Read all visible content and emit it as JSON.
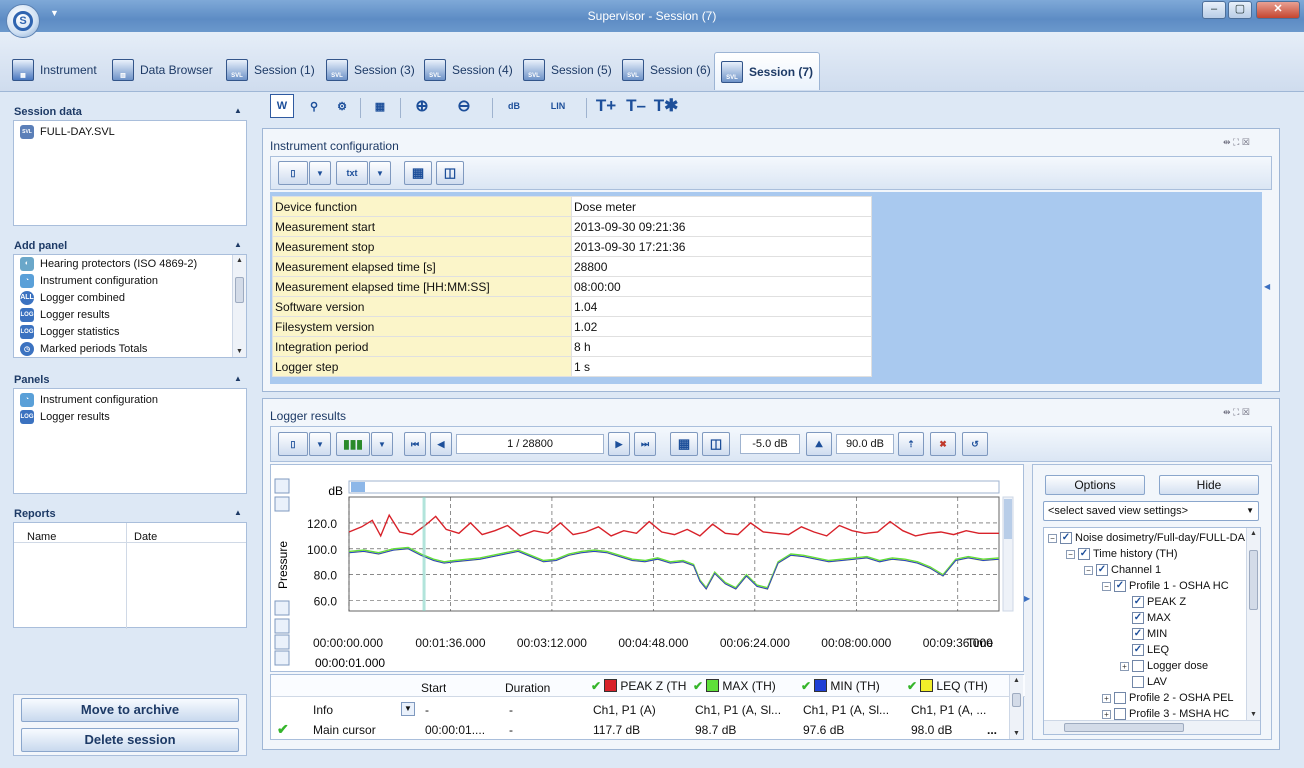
{
  "window": {
    "title": "Supervisor - Session (7)",
    "min": "–",
    "max": "▢",
    "close": "✕"
  },
  "tabs": [
    {
      "label": "Instrument"
    },
    {
      "label": "Data Browser"
    },
    {
      "label": "Session (1)"
    },
    {
      "label": "Session (3)"
    },
    {
      "label": "Session (4)"
    },
    {
      "label": "Session (5)"
    },
    {
      "label": "Session (6)"
    },
    {
      "label": "Session (7)"
    }
  ],
  "sidebar": {
    "session_data": {
      "title": "Session data",
      "items": [
        "FULL-DAY.SVL"
      ]
    },
    "add_panel": {
      "title": "Add panel",
      "items": [
        "Hearing protectors (ISO 4869-2)",
        "Instrument configuration",
        "Logger combined",
        "Logger results",
        "Logger statistics",
        "Marked periods Totals"
      ]
    },
    "panels": {
      "title": "Panels",
      "items": [
        "Instrument configuration",
        "Logger results"
      ]
    },
    "reports": {
      "title": "Reports",
      "col_name": "Name",
      "col_date": "Date"
    },
    "move_to_archive": "Move to archive",
    "delete_session": "Delete session"
  },
  "icons": {
    "log": "LOG",
    "all": "ALL",
    "svl": "SVL",
    "txt": "txt",
    "db": "dB",
    "lin": "LIN",
    "t_plus": "T+",
    "t_minus": "T–",
    "t_star": "T✱"
  },
  "instrument_config": {
    "title": "Instrument configuration",
    "rows": [
      {
        "key": "Device function",
        "value": "Dose meter"
      },
      {
        "key": "Measurement start",
        "value": "2013-09-30 09:21:36"
      },
      {
        "key": "Measurement stop",
        "value": "2013-09-30 17:21:36"
      },
      {
        "key": "Measurement elapsed time [s]",
        "value": "28800"
      },
      {
        "key": "Measurement elapsed time [HH:MM:SS]",
        "value": "08:00:00"
      },
      {
        "key": "Software version",
        "value": "1.04"
      },
      {
        "key": "Filesystem version",
        "value": "1.02"
      },
      {
        "key": "Integration period",
        "value": "8 h"
      },
      {
        "key": "Logger step",
        "value": "1 s"
      }
    ]
  },
  "logger_results": {
    "title": "Logger results",
    "page_counter": "1 / 28800",
    "range_low": "-5.0 dB",
    "range_high": "90.0 dB",
    "cursor_time": "00:00:01.000",
    "grid": {
      "headers": [
        "Start",
        "Duration",
        "PEAK Z (TH",
        "MAX (TH)",
        "MIN (TH)",
        "LEQ (TH)"
      ],
      "info_row": {
        "label": "Info",
        "start": "-",
        "duration": "-",
        "peak": "Ch1, P1 (A)",
        "max": "Ch1, P1 (A, Sl...",
        "min": "Ch1, P1 (A, Sl...",
        "leq": "Ch1, P1 (A, ..."
      },
      "cursor_row": {
        "label": "Main cursor",
        "start": "00:00:01....",
        "duration": "-",
        "peak": "117.7 dB",
        "max": "98.7 dB",
        "min": "97.6 dB",
        "leq": "98.0 dB"
      },
      "more": "..."
    },
    "options_label": "Options",
    "hide_label": "Hide",
    "view_select": "<select saved view settings>",
    "tree": [
      {
        "label": "Noise dosimetry/Full-day/FULL-DA"
      },
      {
        "label": "Time history (TH)"
      },
      {
        "label": "Channel 1"
      },
      {
        "label": "Profile 1 - OSHA HC"
      },
      {
        "label": "PEAK Z"
      },
      {
        "label": "MAX"
      },
      {
        "label": "MIN"
      },
      {
        "label": "LEQ"
      },
      {
        "label": "Logger dose"
      },
      {
        "label": "LAV"
      },
      {
        "label": "Profile 2 - OSHA PEL"
      },
      {
        "label": "Profile 3 - MSHA HC"
      }
    ]
  },
  "colors": {
    "peak": "#d8222a",
    "max": "#5ee03a",
    "min": "#1f3fd6",
    "leq": "#f2ee2a"
  },
  "chart_data": {
    "type": "line",
    "ylabel": "Pressure",
    "yunit": "dB",
    "xlabel": "Time",
    "x_ticks": [
      "00:00:00.000",
      "00:01:36.000",
      "00:03:12.000",
      "00:04:48.000",
      "00:06:24.000",
      "00:08:00.000",
      "00:09:36.000"
    ],
    "y_ticks": [
      120.0,
      100.0,
      80.0,
      60.0
    ],
    "ylim": [
      52,
      140
    ],
    "xlim": [
      0,
      615
    ],
    "grid": true,
    "series": [
      {
        "name": "PEAK Z (TH",
        "color": "#d8222a",
        "points": [
          [
            0,
            113
          ],
          [
            12,
            117
          ],
          [
            22,
            122
          ],
          [
            30,
            110
          ],
          [
            38,
            126
          ],
          [
            48,
            113
          ],
          [
            60,
            111
          ],
          [
            72,
            118
          ],
          [
            82,
            125
          ],
          [
            92,
            115
          ],
          [
            104,
            112
          ],
          [
            115,
            120
          ],
          [
            126,
            111
          ],
          [
            138,
            114
          ],
          [
            150,
            118
          ],
          [
            162,
            110
          ],
          [
            175,
            114
          ],
          [
            188,
            112
          ],
          [
            200,
            120
          ],
          [
            212,
            111
          ],
          [
            224,
            113
          ],
          [
            236,
            117
          ],
          [
            248,
            110
          ],
          [
            260,
            114
          ],
          [
            272,
            112
          ],
          [
            284,
            121
          ],
          [
            296,
            113
          ],
          [
            308,
            111
          ],
          [
            320,
            115
          ],
          [
            332,
            110
          ],
          [
            344,
            119
          ],
          [
            356,
            112
          ],
          [
            368,
            111
          ],
          [
            380,
            120
          ],
          [
            392,
            113
          ],
          [
            404,
            112
          ],
          [
            416,
            111
          ],
          [
            428,
            117
          ],
          [
            440,
            113
          ],
          [
            452,
            110
          ],
          [
            464,
            118
          ],
          [
            476,
            114
          ],
          [
            488,
            112
          ],
          [
            500,
            113
          ],
          [
            512,
            121
          ],
          [
            524,
            114
          ],
          [
            536,
            110
          ],
          [
            548,
            112
          ],
          [
            560,
            113
          ],
          [
            572,
            111
          ],
          [
            584,
            114
          ],
          [
            596,
            112
          ],
          [
            615,
            112
          ]
        ]
      },
      {
        "name": "MAX (TH)",
        "color": "#5ee03a",
        "points": [
          [
            0,
            98
          ],
          [
            14,
            99
          ],
          [
            28,
            97
          ],
          [
            42,
            100
          ],
          [
            56,
            101
          ],
          [
            68,
            96
          ],
          [
            80,
            92
          ],
          [
            90,
            90
          ],
          [
            100,
            91
          ],
          [
            112,
            92
          ],
          [
            124,
            93
          ],
          [
            136,
            95
          ],
          [
            148,
            97
          ],
          [
            160,
            99
          ],
          [
            172,
            95
          ],
          [
            184,
            91
          ],
          [
            196,
            92
          ],
          [
            208,
            96
          ],
          [
            220,
            98
          ],
          [
            232,
            99
          ],
          [
            244,
            98
          ],
          [
            256,
            95
          ],
          [
            268,
            92
          ],
          [
            280,
            91
          ],
          [
            292,
            93
          ],
          [
            304,
            90
          ],
          [
            316,
            91
          ],
          [
            326,
            88
          ],
          [
            332,
            76
          ],
          [
            338,
            70
          ],
          [
            346,
            82
          ],
          [
            356,
            74
          ],
          [
            366,
            70
          ],
          [
            376,
            80
          ],
          [
            386,
            72
          ],
          [
            396,
            70
          ],
          [
            406,
            90
          ],
          [
            418,
            96
          ],
          [
            430,
            95
          ],
          [
            442,
            93
          ],
          [
            454,
            91
          ],
          [
            466,
            92
          ],
          [
            478,
            93
          ],
          [
            490,
            94
          ],
          [
            502,
            91
          ],
          [
            514,
            93
          ],
          [
            526,
            92
          ],
          [
            538,
            90
          ],
          [
            550,
            86
          ],
          [
            562,
            80
          ],
          [
            574,
            92
          ],
          [
            586,
            94
          ],
          [
            600,
            92
          ],
          [
            615,
            93
          ]
        ]
      },
      {
        "name": "MIN (TH)",
        "color": "#1f3fd6",
        "points": [
          [
            0,
            97
          ],
          [
            14,
            98
          ],
          [
            28,
            96
          ],
          [
            42,
            99
          ],
          [
            56,
            100
          ],
          [
            68,
            95
          ],
          [
            80,
            91
          ],
          [
            90,
            89
          ],
          [
            100,
            90
          ],
          [
            112,
            91
          ],
          [
            124,
            92
          ],
          [
            136,
            94
          ],
          [
            148,
            96
          ],
          [
            160,
            98
          ],
          [
            172,
            94
          ],
          [
            184,
            90
          ],
          [
            196,
            91
          ],
          [
            208,
            95
          ],
          [
            220,
            97
          ],
          [
            232,
            98
          ],
          [
            244,
            97
          ],
          [
            256,
            94
          ],
          [
            268,
            91
          ],
          [
            280,
            90
          ],
          [
            292,
            92
          ],
          [
            304,
            89
          ],
          [
            316,
            90
          ],
          [
            326,
            87
          ],
          [
            332,
            75
          ],
          [
            338,
            69
          ],
          [
            346,
            81
          ],
          [
            356,
            73
          ],
          [
            366,
            69
          ],
          [
            376,
            79
          ],
          [
            386,
            71
          ],
          [
            396,
            69
          ],
          [
            406,
            89
          ],
          [
            418,
            95
          ],
          [
            430,
            94
          ],
          [
            442,
            92
          ],
          [
            454,
            90
          ],
          [
            466,
            91
          ],
          [
            478,
            92
          ],
          [
            490,
            93
          ],
          [
            502,
            90
          ],
          [
            514,
            92
          ],
          [
            526,
            91
          ],
          [
            538,
            89
          ],
          [
            550,
            85
          ],
          [
            562,
            79
          ],
          [
            574,
            91
          ],
          [
            586,
            93
          ],
          [
            600,
            91
          ],
          [
            615,
            92
          ]
        ]
      },
      {
        "name": "LEQ (TH)",
        "color": "#f2ee2a",
        "points": [
          [
            0,
            97
          ],
          [
            14,
            98
          ],
          [
            28,
            96
          ],
          [
            42,
            99
          ],
          [
            56,
            100
          ],
          [
            68,
            95
          ],
          [
            80,
            91
          ],
          [
            90,
            89
          ],
          [
            100,
            90
          ],
          [
            112,
            91
          ],
          [
            124,
            92
          ],
          [
            136,
            94
          ],
          [
            148,
            96
          ],
          [
            160,
            98
          ],
          [
            172,
            94
          ],
          [
            184,
            90
          ],
          [
            196,
            91
          ],
          [
            208,
            95
          ],
          [
            220,
            97
          ],
          [
            232,
            98
          ],
          [
            244,
            97
          ],
          [
            256,
            94
          ],
          [
            268,
            91
          ],
          [
            280,
            90
          ],
          [
            292,
            92
          ],
          [
            304,
            89
          ],
          [
            316,
            90
          ],
          [
            326,
            87
          ],
          [
            332,
            75
          ],
          [
            338,
            69
          ],
          [
            346,
            81
          ],
          [
            356,
            73
          ],
          [
            366,
            69
          ],
          [
            376,
            79
          ],
          [
            386,
            71
          ],
          [
            396,
            69
          ],
          [
            406,
            89
          ],
          [
            418,
            95
          ],
          [
            430,
            94
          ],
          [
            442,
            92
          ],
          [
            454,
            90
          ],
          [
            466,
            91
          ],
          [
            478,
            92
          ],
          [
            490,
            93
          ],
          [
            502,
            90
          ],
          [
            514,
            92
          ],
          [
            526,
            91
          ],
          [
            538,
            89
          ],
          [
            550,
            85
          ],
          [
            562,
            79
          ],
          [
            574,
            91
          ],
          [
            586,
            93
          ],
          [
            600,
            91
          ],
          [
            615,
            92
          ]
        ]
      }
    ]
  }
}
